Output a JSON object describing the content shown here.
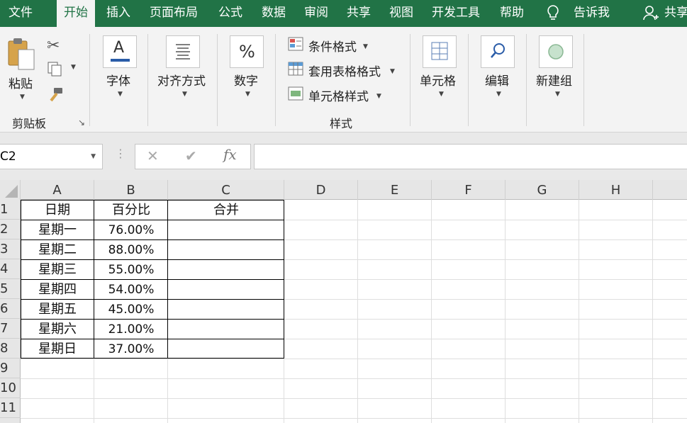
{
  "menu": {
    "file": "文件",
    "home": "开始",
    "insert": "插入",
    "page_layout": "页面布局",
    "formulas": "公式",
    "data": "数据",
    "review": "审阅",
    "share_tab": "共享",
    "view": "视图",
    "developer": "开发工具",
    "help": "帮助",
    "tell_me": "告诉我",
    "share": "共享"
  },
  "ribbon": {
    "paste": "粘贴",
    "clipboard": "剪贴板",
    "font": "字体",
    "alignment": "对齐方式",
    "number": "数字",
    "conditional_format": "条件格式",
    "table_format": "套用表格格式",
    "cell_styles": "单元格样式",
    "styles": "样式",
    "cells": "单元格",
    "editing": "编辑",
    "new_group": "新建组"
  },
  "formula_bar": {
    "name_box": "C2",
    "fx": "fx",
    "value": ""
  },
  "columns": [
    "A",
    "B",
    "C",
    "D",
    "E",
    "F",
    "G",
    "H"
  ],
  "rows": [
    "1",
    "2",
    "3",
    "4",
    "5",
    "6",
    "7",
    "8",
    "9",
    "10",
    "11"
  ],
  "table": {
    "headers": [
      "日期",
      "百分比",
      "合并"
    ],
    "rows": [
      [
        "星期一",
        "76.00%",
        ""
      ],
      [
        "星期二",
        "88.00%",
        ""
      ],
      [
        "星期三",
        "55.00%",
        ""
      ],
      [
        "星期四",
        "54.00%",
        ""
      ],
      [
        "星期五",
        "45.00%",
        ""
      ],
      [
        "星期六",
        "21.00%",
        ""
      ],
      [
        "星期日",
        "37.00%",
        ""
      ]
    ]
  },
  "colors": {
    "menu_bg": "#217346",
    "ribbon_bg": "#f3f3f3"
  }
}
